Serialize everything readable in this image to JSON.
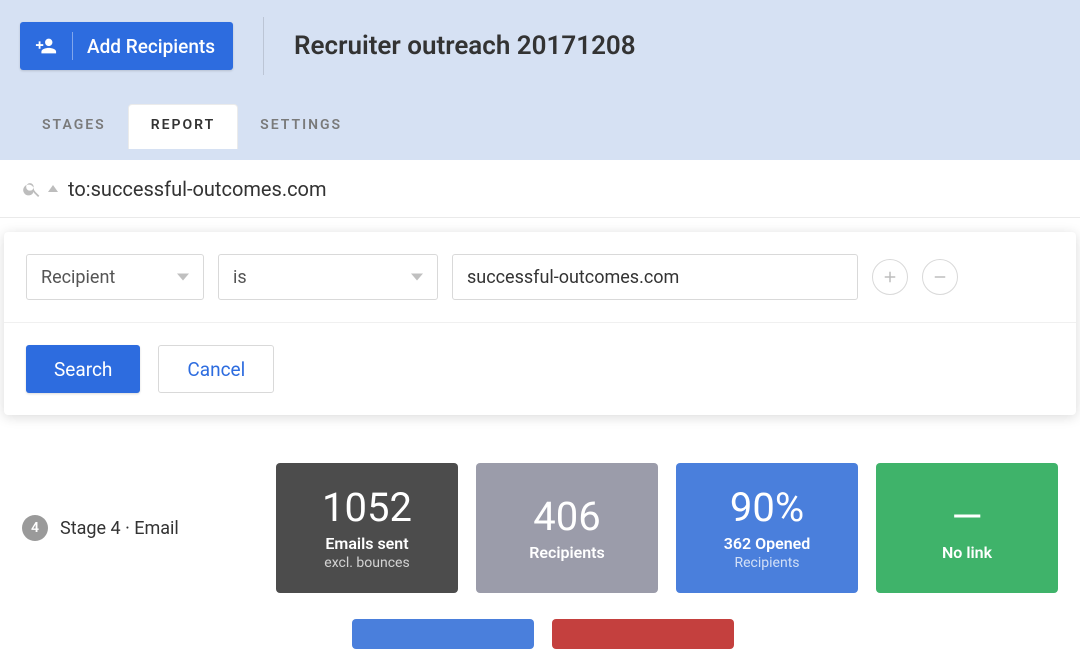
{
  "header": {
    "add_recipients_label": "Add Recipients",
    "title": "Recruiter outreach 20171208"
  },
  "tabs": {
    "stages": "STAGES",
    "report": "REPORT",
    "settings": "SETTINGS"
  },
  "search": {
    "query": "to:successful-outcomes.com"
  },
  "filter": {
    "field": "Recipient",
    "operator": "is",
    "value": "successful-outcomes.com",
    "search_label": "Search",
    "cancel_label": "Cancel"
  },
  "stage": {
    "number": "4",
    "label": "Stage 4 · Email"
  },
  "stats": {
    "sent": {
      "value": "1052",
      "label": "Emails sent",
      "sub": "excl. bounces"
    },
    "recipients": {
      "value": "406",
      "label": "Recipients"
    },
    "opened": {
      "value": "90%",
      "label": "362 Opened",
      "sub": "Recipients"
    },
    "links": {
      "value": "—",
      "label": "No link"
    }
  }
}
